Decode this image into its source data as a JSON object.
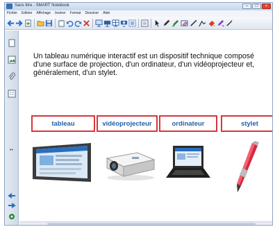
{
  "window": {
    "title": "Sans titre - SMART Notebook"
  },
  "menu": {
    "items": [
      "Fichier",
      "Edition",
      "Affichage",
      "Insérer",
      "Format",
      "Dessiner",
      "Aide"
    ]
  },
  "toolbar": {
    "icons": [
      "back-icon",
      "forward-icon",
      "add-page-icon",
      "open-icon",
      "save-icon",
      "paste-icon",
      "undo-icon",
      "redo-icon",
      "delete-icon",
      "screen-shade-icon",
      "display-icon",
      "table-icon",
      "camera-icon",
      "capture-icon",
      "select-icon",
      "pen-icon",
      "creative-pen-icon",
      "eraser-icon",
      "line-icon",
      "shape-icon",
      "fill-icon",
      "properties-icon"
    ]
  },
  "sidebar": {
    "icons": [
      "page-sorter-icon",
      "gallery-icon",
      "attachments-icon",
      "properties-icon",
      "left-arrow-icon",
      "right-arrow-icon",
      "settings-icon"
    ]
  },
  "content": {
    "intro": "Un tableau numérique interactif est un dispositif technique composé d'une surface de projection, d'un ordinateur, d'un vidéoprojecteur et, généralement, d'un stylet.",
    "labels": [
      "tableau",
      "vidéoprojecteur",
      "ordinateur",
      "stylet"
    ]
  },
  "colors": {
    "label_border": "#d9343c",
    "label_text": "#1f5fa8",
    "titlebar": "#c5d6ec"
  }
}
